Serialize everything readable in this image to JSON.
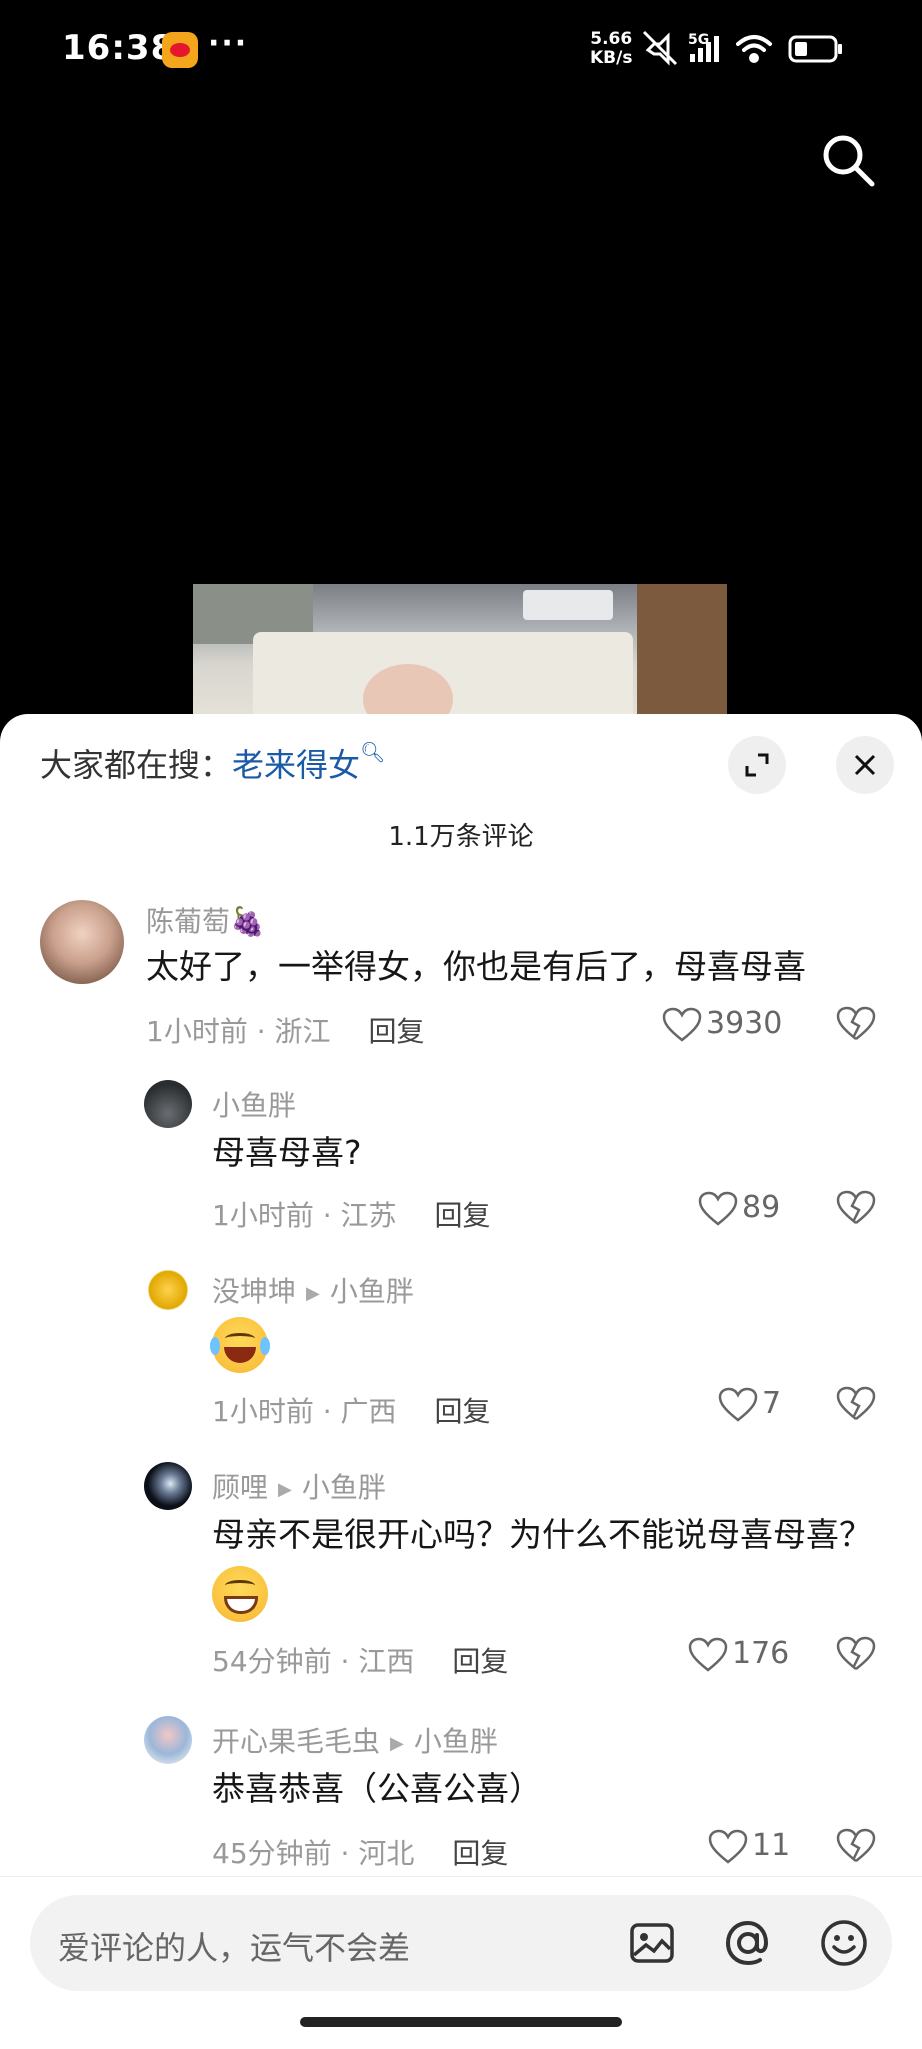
{
  "status_bar": {
    "time": "16:38",
    "dots": "···",
    "speed_value": "5.66",
    "speed_unit": "KB/s",
    "network": "5G",
    "icons": [
      "weibo-icon",
      "mute-icon",
      "signal-icon",
      "wifi-icon",
      "battery-icon"
    ]
  },
  "video": {
    "search_icon": "search-icon"
  },
  "panel": {
    "hot_search_prefix": "大家都在搜：",
    "hot_search_keyword": "老来得女",
    "comment_count": "1.1万条评论"
  },
  "comments": [
    {
      "user": "陈葡萄",
      "badge": "🍇",
      "text": "太好了，一举得女，你也是有后了，母喜母喜",
      "time": "1小时前",
      "location": "浙江",
      "reply": "回复",
      "likes": "3930"
    },
    {
      "user": "小鱼胖",
      "text": "母喜母喜?",
      "time": "1小时前",
      "location": "江苏",
      "reply": "回复",
      "likes": "89"
    },
    {
      "user": "没坤坤",
      "reply_to": "小鱼胖",
      "text": "😂",
      "time": "1小时前",
      "location": "广西",
      "reply": "回复",
      "likes": "7"
    },
    {
      "user": "顾哩",
      "reply_to": "小鱼胖",
      "text": "母亲不是很开心吗？为什么不能说母喜母喜？",
      "time": "54分钟前",
      "location": "江西",
      "reply": "回复",
      "likes": "176"
    },
    {
      "user": "开心果毛毛虫",
      "reply_to": "小鱼胖",
      "text": "恭喜恭喜（公喜公喜）",
      "time": "45分钟前",
      "location": "河北",
      "reply": "回复",
      "likes": "11"
    }
  ],
  "input": {
    "placeholder": "爱评论的人，运气不会差",
    "icons": [
      "image-icon",
      "at-icon",
      "emoji-icon"
    ]
  },
  "colors": {
    "keyword": "#1a5aa6",
    "meta": "#999999",
    "text": "#161616"
  }
}
